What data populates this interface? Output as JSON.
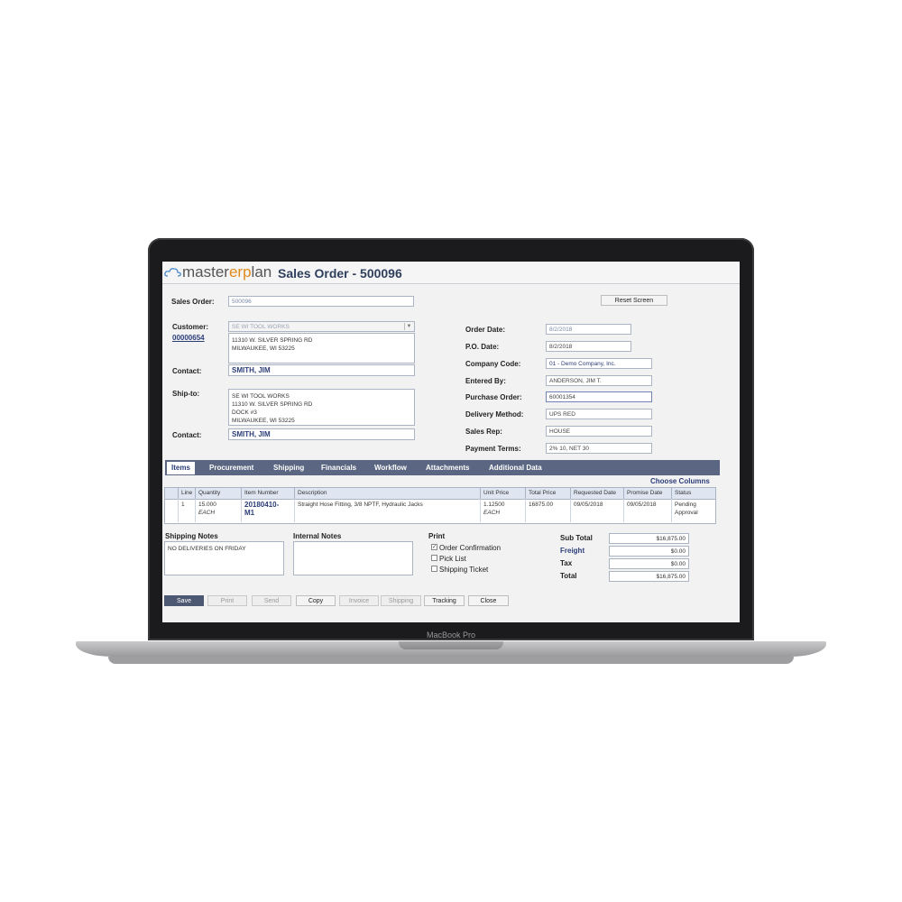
{
  "device": {
    "label": "MacBook Pro"
  },
  "app": {
    "logo_prefix": "master",
    "logo_erp": "erp",
    "logo_suffix": "lan",
    "title": "Sales Order - 500096",
    "reset_button": "Reset Screen"
  },
  "form": {
    "sales_order_label": "Sales Order:",
    "sales_order_value": "500096",
    "customer_label": "Customer:",
    "customer_id": "00000654",
    "customer_select": "SE WI TOOL WORKS",
    "customer_address_line1": "11310 W. SILVER SPRING RD",
    "customer_address_line2": "MILWAUKEE, WI  53225",
    "contact_label": "Contact:",
    "contact_name": "SMITH, JIM",
    "shipto_label": "Ship-to:",
    "shipto_line1": "SE WI TOOL WORKS",
    "shipto_line2": "11310 W. SILVER SPRING RD",
    "shipto_line3": "DOCK #3",
    "shipto_line4": "MILWAUKEE, WI  53225",
    "contact2_label": "Contact:",
    "contact2_name": "SMITH, JIM",
    "order_date_label": "Order Date:",
    "order_date": "8/2/2018",
    "po_date_label": "P.O. Date:",
    "po_date": "8/2/2018",
    "company_code_label": "Company Code:",
    "company_code": "01 - Demo Company, Inc.",
    "entered_by_label": "Entered By:",
    "entered_by": "ANDERSON, JIM T.",
    "purchase_order_label": "Purchase Order:",
    "purchase_order": "60001354",
    "delivery_method_label": "Delivery Method:",
    "delivery_method": "UPS RED",
    "sales_rep_label": "Sales Rep:",
    "sales_rep": "HOUSE",
    "payment_terms_label": "Payment Terms:",
    "payment_terms": "2% 10, NET 30"
  },
  "tabs": [
    "Items",
    "Procurement",
    "Shipping",
    "Financials",
    "Workflow",
    "Attachments",
    "Additional Data"
  ],
  "grid": {
    "choose_columns": "Choose Columns",
    "headers": [
      "Line",
      "Quantity",
      "Item Number",
      "Description",
      "Unit Price",
      "Total Price",
      "Requested Date",
      "Promise Date",
      "Status"
    ],
    "row": {
      "line": "1",
      "quantity": "15.000",
      "quantity_unit": "EACH",
      "item_number_1": "20180410-",
      "item_number_2": "M1",
      "description": "Straight Hose Fitting, 3/8 NPTF, Hydraulic Jacks",
      "unit_price": "1.12500",
      "unit_price_unit": "EACH",
      "total_price": "16875.00",
      "requested_date": "09/05/2018",
      "promise_date": "09/05/2018",
      "status_1": "Pending",
      "status_2": "Approval"
    }
  },
  "notes": {
    "shipping_label": "Shipping Notes",
    "shipping_text": "NO DELIVERIES ON FRIDAY",
    "internal_label": "Internal Notes",
    "internal_text": ""
  },
  "print": {
    "label": "Print",
    "order_confirmation": "Order Confirmation",
    "order_confirmation_checked": true,
    "pick_list": "Pick List",
    "pick_list_checked": false,
    "shipping_ticket": "Shipping Ticket",
    "shipping_ticket_checked": false
  },
  "totals": {
    "subtotal_label": "Sub Total",
    "subtotal": "$16,875.00",
    "freight_label": "Freight",
    "freight": "$0.00",
    "tax_label": "Tax",
    "tax": "$0.00",
    "total_label": "Total",
    "total": "$16,875.00"
  },
  "buttons": {
    "save": "Save",
    "print": "Print",
    "send": "Send",
    "copy": "Copy",
    "invoice": "Invoice",
    "shipping": "Shipping",
    "tracking": "Tracking",
    "close": "Close"
  },
  "colors": {
    "tab_bar": "#5a6682",
    "accent": "#2c3e78",
    "logo_orange": "#e08a1e",
    "save_button": "#4d5872"
  }
}
